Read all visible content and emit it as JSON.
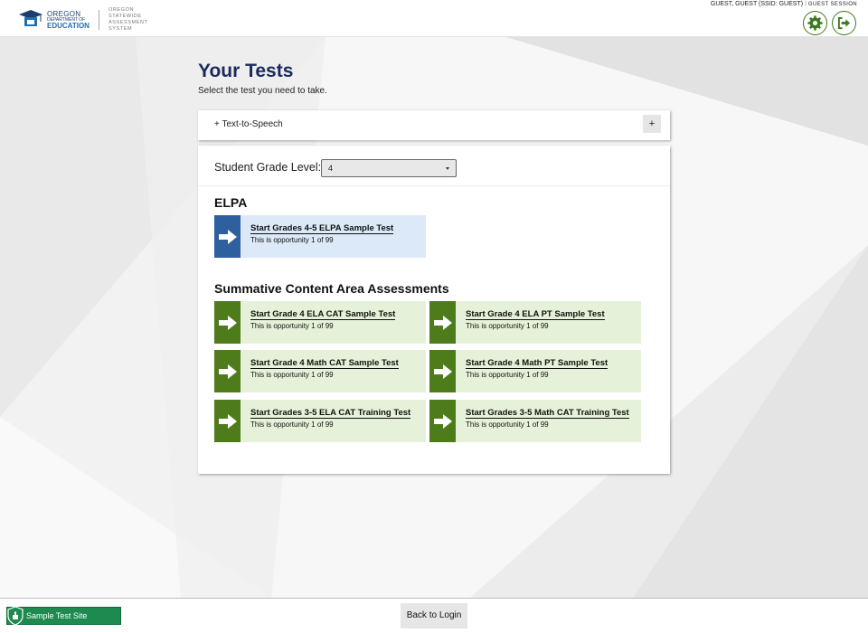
{
  "header": {
    "logo": {
      "line1": "OREGON",
      "line2": "DEPARTMENT OF",
      "line3": "EDUCATION",
      "system_line1": "OREGON STATEWIDE",
      "system_line2": "ASSESSMENT SYSTEM"
    },
    "user": "GUEST, GUEST (SSID: GUEST)",
    "session": "GUEST SESSION",
    "icons": {
      "settings": "gear-icon",
      "logout": "logout-icon"
    },
    "accent_color": "#3b7a1e"
  },
  "main": {
    "title": "Your Tests",
    "subtitle": "Select the test you need to take.",
    "tts": {
      "label": "+ Text-to-Speech",
      "toggle": "+"
    },
    "grade": {
      "label": "Student Grade Level:",
      "value": "4"
    },
    "elpa": {
      "title": "ELPA",
      "tests": [
        {
          "name": "Start Grades 4-5 ELPA Sample Test",
          "opportunity": "This is opportunity 1 of 99"
        }
      ]
    },
    "summative": {
      "title": "Summative Content Area Assessments",
      "tests": [
        {
          "name": "Start Grade 4 ELA CAT Sample Test",
          "opportunity": "This is opportunity 1 of 99"
        },
        {
          "name": "Start Grade 4 ELA PT Sample Test",
          "opportunity": "This is opportunity 1 of 99"
        },
        {
          "name": "Start Grade 4 Math CAT Sample Test",
          "opportunity": "This is opportunity 1 of 99"
        },
        {
          "name": "Start Grade 4 Math PT Sample Test",
          "opportunity": "This is opportunity 1 of 99"
        },
        {
          "name": "Start Grades 3-5 ELA CAT Training Test",
          "opportunity": "This is opportunity 1 of 99"
        },
        {
          "name": "Start Grades 3-5 Math CAT Training Test",
          "opportunity": "This is opportunity 1 of 99"
        }
      ]
    },
    "colors": {
      "elpa_card": "#dbe9f8",
      "elpa_arrow": "#2e5f9e",
      "sca_card": "#e5f1d8",
      "sca_arrow": "#4f7c1a"
    }
  },
  "footer": {
    "site_label": "Sample Test Site",
    "back_button": "Back to Login",
    "site_color": "#1d8a4f"
  }
}
